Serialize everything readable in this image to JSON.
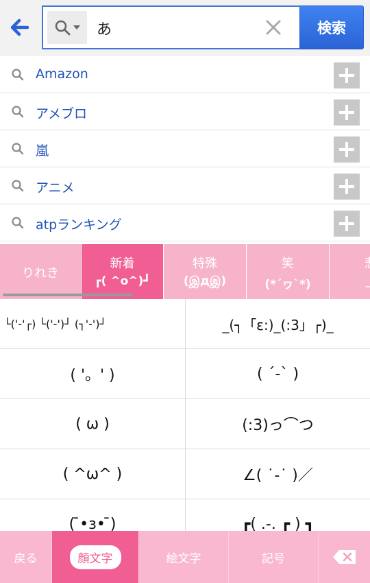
{
  "search": {
    "query": "あ",
    "button_label": "検索"
  },
  "suggestions": [
    {
      "text": "Amazon"
    },
    {
      "text": "アメブロ"
    },
    {
      "text": "嵐"
    },
    {
      "text": "アニメ"
    },
    {
      "text": "atpランキング"
    }
  ],
  "categories": [
    {
      "line1": "りれき",
      "line2": ""
    },
    {
      "line1": "新着",
      "line2": "┏( ^o^)┛"
    },
    {
      "line1": "特殊",
      "line2": "(இдஇ)"
    },
    {
      "line1": "笑",
      "line2": "(*´ヮ`*)"
    },
    {
      "line1": "悲",
      "line2": "_|"
    }
  ],
  "emoticons": [
    "└('-'┌) └('-')┘ (┐'-')┘",
    "_(┐「ε:)_(:3」┌)_",
    "( '。' )",
    "( ´-` )",
    "( ω )",
    "(:3)っ⌒つ",
    "( ^ω^ )",
    "∠( ˙-˙ )／",
    "( ̄•з• ̄)",
    "┏( .-. ┏ ) ┓"
  ],
  "bottom_bar": {
    "back": "戻る",
    "kaomoji": "顔文字",
    "emoji": "絵文字",
    "symbols": "記号"
  },
  "colors": {
    "accent_blue": "#3f82f0",
    "pink_light": "#f7b3c9",
    "pink_active": "#f05e93",
    "link_blue": "#1f52b5"
  }
}
